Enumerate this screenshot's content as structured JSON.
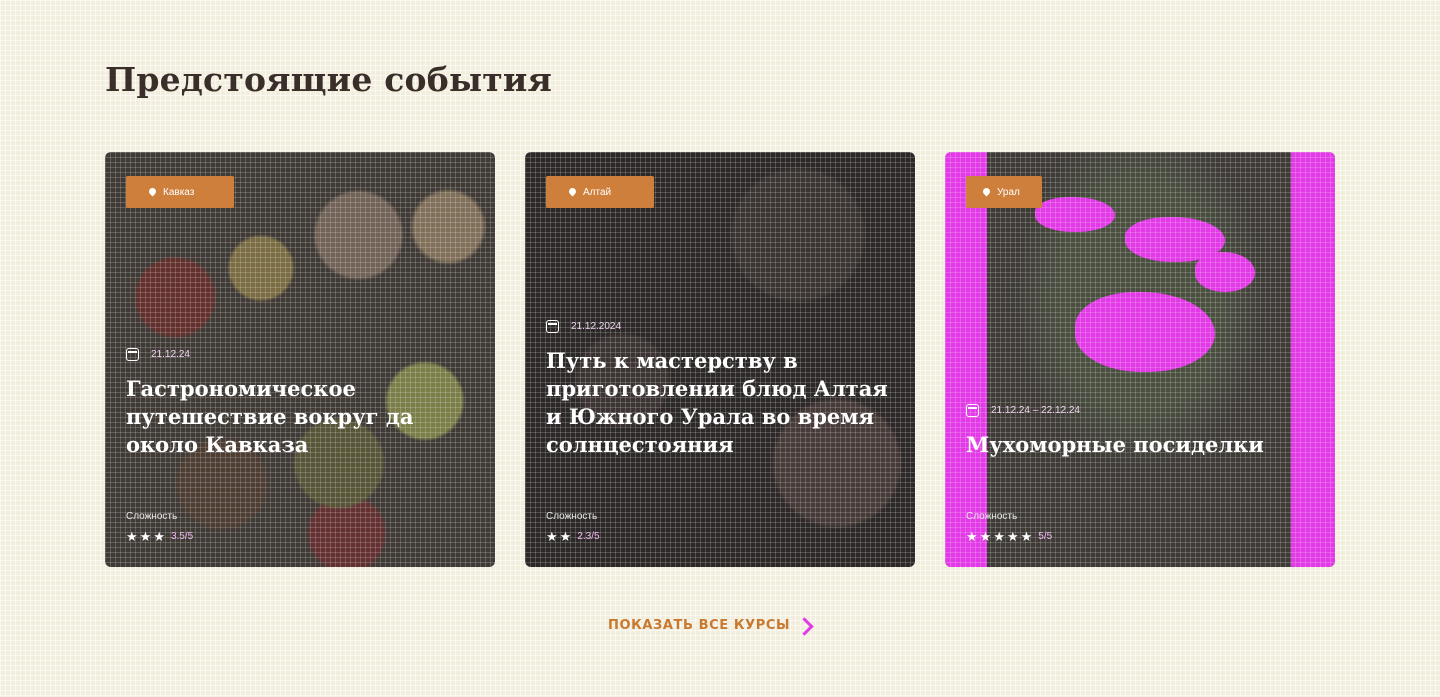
{
  "section": {
    "title": "Предстоящие события"
  },
  "events": [
    {
      "location": "Кавказ",
      "date": "21.12.24",
      "title": "Гастрономическое путешествие вокруг да около Кавказа",
      "difficulty_label": "Сложность",
      "difficulty_value": "3.5/5",
      "difficulty_stars": 3
    },
    {
      "location": "Алтай",
      "date": "21.12.2024",
      "title": "Путь к мастерству в приготовлении блюд Алтая и Южного Урала во время солнцестояния",
      "difficulty_label": "Сложность",
      "difficulty_value": "2.3/5",
      "difficulty_stars": 2
    },
    {
      "location": "Урал",
      "date": "21.12.24 – 22.12.24",
      "title": "Мухоморные посиделки",
      "difficulty_label": "Сложность",
      "difficulty_value": "5/5",
      "difficulty_stars": 5
    }
  ],
  "footer": {
    "show_all_label": "ПОКАЗАТЬ ВСЕ КУРСЫ"
  },
  "colors": {
    "background": "#f1eedd",
    "title": "#3a2e2a",
    "accent_orange": "#cf7f3c",
    "link": "#c9792f",
    "highlight_magenta": "#e23ae6"
  },
  "icons": {
    "location": "pin-icon",
    "date": "calendar-icon",
    "rating": "star-icon",
    "arrow": "chevron-right-icon"
  }
}
